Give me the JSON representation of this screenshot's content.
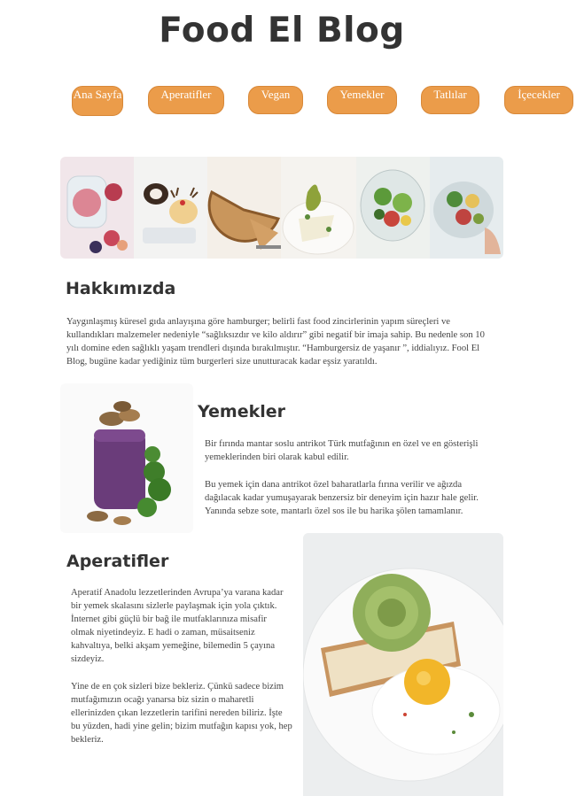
{
  "site": {
    "title": "Food El Blog"
  },
  "nav": {
    "items": [
      {
        "label": "Ana Sayfa"
      },
      {
        "label": "Aperatifler"
      },
      {
        "label": "Vegan"
      },
      {
        "label": "Yemekler"
      },
      {
        "label": "Tatlılar"
      },
      {
        "label": "İçecekler"
      }
    ]
  },
  "gallery": {
    "photos": [
      "figs-jar-photo",
      "cake-roll-dessert-photo",
      "pie-slice-photo",
      "pear-plate-photo",
      "salad-bowl-photo",
      "fruit-bowl-photo"
    ]
  },
  "about": {
    "title": "Hakkımızda",
    "text": "Yaygınlaşmış küresel gıda anlayışına göre hamburger; belirli fast food zincirlerinin yapım süreçleri ve kullandıkları malzemeler nedeniyle “sağlıksızdır ve kilo aldırır” gibi negatif bir imaja sahip. Bu nedenle son 10 yılı domine eden sağlıklı yaşam trendleri dışında bırakılmıştır. “Hamburgersiz de yaşanır ”, iddialıyız. Fool El Blog, bugüne kadar yediğiniz tüm burgerleri size unutturacak kadar eşsiz yaratıldı."
  },
  "yemekler": {
    "title": "Yemekler",
    "p1": "Bir fırında mantar soslu antrikot Türk mutfağının en özel ve en gösterişli yemeklerinden biri olarak kabul edilir.",
    "p2": "Bu yemek için dana antrikot özel baharatlarla fırına verilir ve ağızda dağılacak kadar yumuşayarak benzersiz bir deneyim için hazır hale gelir. Yanında sebze sote, mantarlı özel sos ile bu harika şölen tamamlanır."
  },
  "aperatifler": {
    "title": "Aperatifler",
    "p1": "Aperatif Anadolu lezzetlerinden Avrupa’ya varana kadar bir yemek skalasını sizlerle paylaşmak için yola çıktık. İnternet gibi güçlü bir bağ ile mutfaklarınıza misafir olmak niyetindeyiz. E hadi o zaman, müsaitseniz kahvaltıya, belki akşam yemeğine, bilemedin 5 çayına sizdeyiz.",
    "p2": "Yine de en çok sizleri bize bekleriz. Çünkü sadece bizim mutfağımızın ocağı yanarsa biz sizin o maharetli ellerinizden çıkan lezzetlerin tarifini nereden biliriz. İşte bu yüzden, hadi yine gelin; bizim mutfağın kapısı yok, hep bekleriz."
  },
  "colors": {
    "nav_button": "#eb9c4a",
    "text": "#333333"
  }
}
